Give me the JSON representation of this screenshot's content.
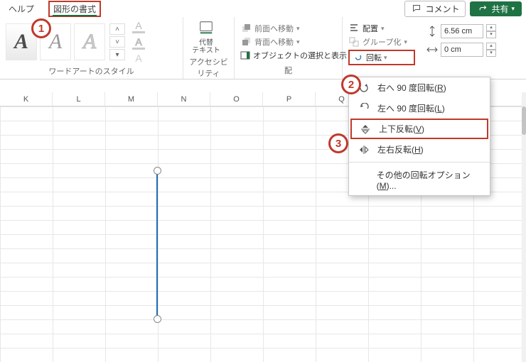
{
  "tabs": {
    "help": "ヘルプ",
    "shape_format": "図形の書式"
  },
  "topbar": {
    "comment": "コメント",
    "share": "共有"
  },
  "wordart": {
    "group_label": "ワードアートのスタイル"
  },
  "accessibility": {
    "alt_text": "代替\nテキスト",
    "group_label": "アクセシビリティ"
  },
  "arrange": {
    "bring_forward": "前面へ移動",
    "send_backward": "背面へ移動",
    "selection_pane": "オブジェクトの選択と表示",
    "align": "配置",
    "group": "グループ化",
    "rotate": "回転",
    "group_label_left": "配"
  },
  "size": {
    "height": "6.56 cm",
    "width": "0 cm"
  },
  "menu": {
    "rotate_right": "右へ 90 度回転(",
    "rotate_right_key": "R",
    "rotate_right_tail": ")",
    "rotate_left": "左へ 90 度回転(",
    "rotate_left_key": "L",
    "rotate_left_tail": ")",
    "flip_vertical": "上下反転(",
    "flip_vertical_key": "V",
    "flip_vertical_tail": ")",
    "flip_horizontal": "左右反転(",
    "flip_horizontal_key": "H",
    "flip_horizontal_tail": ")",
    "more": "その他の回転オプション(",
    "more_key": "M",
    "more_tail": ")..."
  },
  "columns": [
    "K",
    "L",
    "M",
    "N",
    "O",
    "P",
    "Q"
  ],
  "callouts": {
    "one": "1",
    "two": "2",
    "three": "3"
  }
}
